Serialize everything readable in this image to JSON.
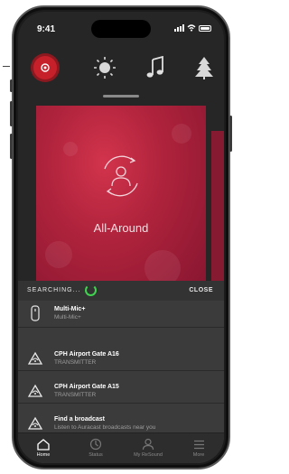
{
  "status_bar": {
    "time": "9:41"
  },
  "toolbar": {
    "items": [
      {
        "icon": "record-button-icon",
        "color": "#c6202a"
      },
      {
        "icon": "sun-icon"
      },
      {
        "icon": "music-note-icon"
      },
      {
        "icon": "tree-icon"
      }
    ]
  },
  "program": {
    "label": "All-Around",
    "icon": "person-circle-arrows-icon",
    "color": "#b0233c"
  },
  "search": {
    "status_label": "SEARCHING...",
    "close_label": "CLOSE",
    "spinner_color": "#3fd34f"
  },
  "devices": [
    {
      "title": "Multi-Mic+",
      "subtitle": "Multi-Mic+",
      "icon": "microphone-device-icon"
    },
    {
      "title": "CPH Airport Gate A16",
      "subtitle": "TRANSMITTER",
      "icon": "broadcast-icon"
    },
    {
      "title": "CPH Airport Gate A15",
      "subtitle": "TRANSMITTER",
      "icon": "broadcast-icon"
    },
    {
      "title": "Find a broadcast",
      "subtitle": "Listen to Auracast broadcasts near you",
      "icon": "broadcast-icon"
    }
  ],
  "tabs": [
    {
      "label": "Home",
      "icon": "home-icon",
      "active": true
    },
    {
      "label": "Status",
      "icon": "status-icon",
      "active": false
    },
    {
      "label": "My ReSound",
      "icon": "person-icon",
      "active": false
    },
    {
      "label": "More",
      "icon": "menu-icon",
      "active": false
    }
  ]
}
